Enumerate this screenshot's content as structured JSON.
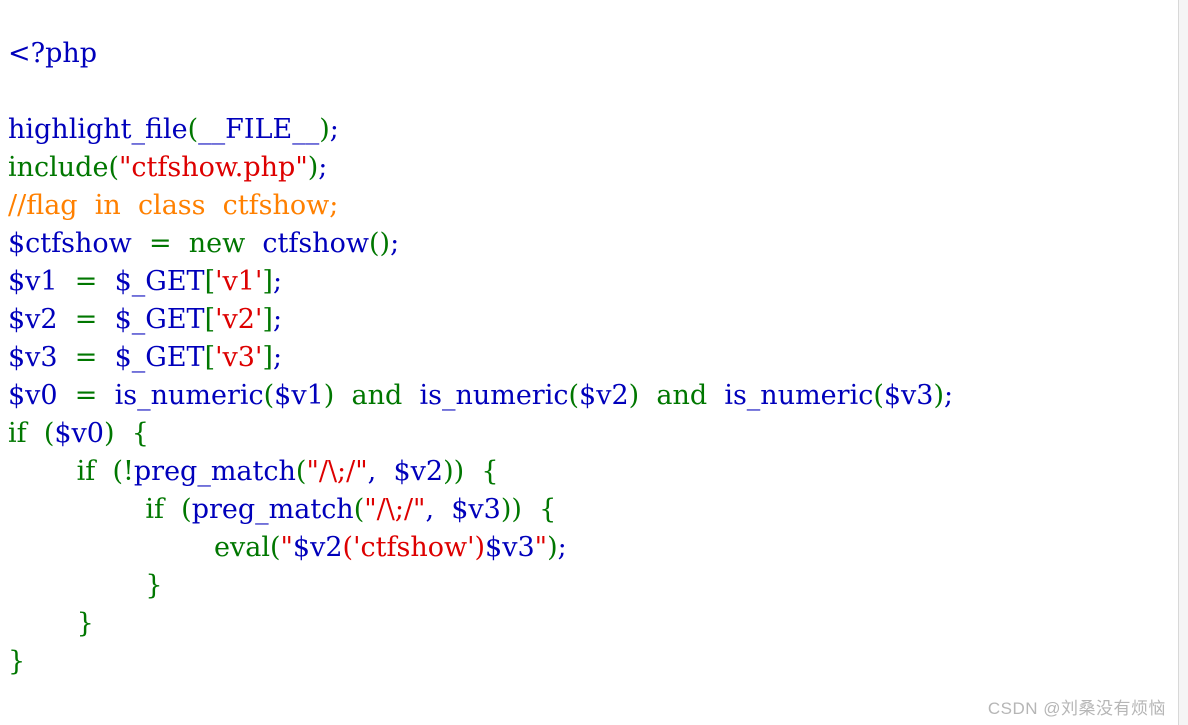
{
  "editor": {
    "language": "php",
    "background": "#ffffff",
    "palette": {
      "default": "#0000BB",
      "keyword": "#007700",
      "string": "#DD0000",
      "comment": "#FF8000"
    },
    "lines": [
      {
        "index": 1,
        "text": "<?php"
      },
      {
        "index": 2,
        "text": ""
      },
      {
        "index": 3,
        "text": "highlight_file(__FILE__);"
      },
      {
        "index": 4,
        "text": "include(\"ctfshow.php\");"
      },
      {
        "index": 5,
        "text": "//flag  in  class  ctfshow;"
      },
      {
        "index": 6,
        "text": "$ctfshow  =  new  ctfshow();"
      },
      {
        "index": 7,
        "text": "$v1  =  $_GET['v1'];"
      },
      {
        "index": 8,
        "text": "$v2  =  $_GET['v2'];"
      },
      {
        "index": 9,
        "text": "$v3  =  $_GET['v3'];"
      },
      {
        "index": 10,
        "text": "$v0  =  is_numeric($v1)  and  is_numeric($v2)  and  is_numeric($v3);"
      },
      {
        "index": 11,
        "text": "if  ($v0)  {"
      },
      {
        "index": 12,
        "text": "        if  (!preg_match(\"/\\;/\",  $v2))  {"
      },
      {
        "index": 13,
        "text": "                if  (preg_match(\"/\\;/\",  $v3))  {"
      },
      {
        "index": 14,
        "text": "                        eval(\"$v2('ctfshow')$v3\");"
      },
      {
        "index": 15,
        "text": "                }"
      },
      {
        "index": 16,
        "text": "        }"
      },
      {
        "index": 17,
        "text": "}"
      }
    ],
    "tokens": [
      [
        {
          "t": "<?php",
          "c": "default"
        }
      ],
      [
        {
          "t": "",
          "c": "default"
        }
      ],
      [
        {
          "t": "highlight_file",
          "c": "default"
        },
        {
          "t": "(",
          "c": "keyword"
        },
        {
          "t": "__FILE__",
          "c": "default"
        },
        {
          "t": ")",
          "c": "keyword"
        },
        {
          "t": ";",
          "c": "default"
        }
      ],
      [
        {
          "t": "include",
          "c": "keyword"
        },
        {
          "t": "(",
          "c": "keyword"
        },
        {
          "t": "\"ctfshow.php\"",
          "c": "string"
        },
        {
          "t": ")",
          "c": "keyword"
        },
        {
          "t": ";",
          "c": "default"
        }
      ],
      [
        {
          "t": "//flag  in  class  ctfshow;",
          "c": "comment"
        }
      ],
      [
        {
          "t": "$ctfshow",
          "c": "default"
        },
        {
          "t": "  ",
          "c": "default"
        },
        {
          "t": "=",
          "c": "keyword"
        },
        {
          "t": "  ",
          "c": "default"
        },
        {
          "t": "new",
          "c": "keyword"
        },
        {
          "t": "  ",
          "c": "default"
        },
        {
          "t": "ctfshow",
          "c": "default"
        },
        {
          "t": "(",
          "c": "keyword"
        },
        {
          "t": ")",
          "c": "keyword"
        },
        {
          "t": ";",
          "c": "default"
        }
      ],
      [
        {
          "t": "$v1",
          "c": "default"
        },
        {
          "t": "  ",
          "c": "default"
        },
        {
          "t": "=",
          "c": "keyword"
        },
        {
          "t": "  ",
          "c": "default"
        },
        {
          "t": "$_GET",
          "c": "default"
        },
        {
          "t": "[",
          "c": "keyword"
        },
        {
          "t": "'v1'",
          "c": "string"
        },
        {
          "t": "]",
          "c": "keyword"
        },
        {
          "t": ";",
          "c": "default"
        }
      ],
      [
        {
          "t": "$v2",
          "c": "default"
        },
        {
          "t": "  ",
          "c": "default"
        },
        {
          "t": "=",
          "c": "keyword"
        },
        {
          "t": "  ",
          "c": "default"
        },
        {
          "t": "$_GET",
          "c": "default"
        },
        {
          "t": "[",
          "c": "keyword"
        },
        {
          "t": "'v2'",
          "c": "string"
        },
        {
          "t": "]",
          "c": "keyword"
        },
        {
          "t": ";",
          "c": "default"
        }
      ],
      [
        {
          "t": "$v3",
          "c": "default"
        },
        {
          "t": "  ",
          "c": "default"
        },
        {
          "t": "=",
          "c": "keyword"
        },
        {
          "t": "  ",
          "c": "default"
        },
        {
          "t": "$_GET",
          "c": "default"
        },
        {
          "t": "[",
          "c": "keyword"
        },
        {
          "t": "'v3'",
          "c": "string"
        },
        {
          "t": "]",
          "c": "keyword"
        },
        {
          "t": ";",
          "c": "default"
        }
      ],
      [
        {
          "t": "$v0",
          "c": "default"
        },
        {
          "t": "  ",
          "c": "default"
        },
        {
          "t": "=",
          "c": "keyword"
        },
        {
          "t": "  ",
          "c": "default"
        },
        {
          "t": "is_numeric",
          "c": "default"
        },
        {
          "t": "(",
          "c": "keyword"
        },
        {
          "t": "$v1",
          "c": "default"
        },
        {
          "t": ")",
          "c": "keyword"
        },
        {
          "t": "  ",
          "c": "default"
        },
        {
          "t": "and",
          "c": "keyword"
        },
        {
          "t": "  ",
          "c": "default"
        },
        {
          "t": "is_numeric",
          "c": "default"
        },
        {
          "t": "(",
          "c": "keyword"
        },
        {
          "t": "$v2",
          "c": "default"
        },
        {
          "t": ")",
          "c": "keyword"
        },
        {
          "t": "  ",
          "c": "default"
        },
        {
          "t": "and",
          "c": "keyword"
        },
        {
          "t": "  ",
          "c": "default"
        },
        {
          "t": "is_numeric",
          "c": "default"
        },
        {
          "t": "(",
          "c": "keyword"
        },
        {
          "t": "$v3",
          "c": "default"
        },
        {
          "t": ")",
          "c": "keyword"
        },
        {
          "t": ";",
          "c": "default"
        }
      ],
      [
        {
          "t": "if",
          "c": "keyword"
        },
        {
          "t": "  ",
          "c": "default"
        },
        {
          "t": "(",
          "c": "keyword"
        },
        {
          "t": "$v0",
          "c": "default"
        },
        {
          "t": ")",
          "c": "keyword"
        },
        {
          "t": "  ",
          "c": "default"
        },
        {
          "t": "{",
          "c": "keyword"
        }
      ],
      [
        {
          "t": "        ",
          "c": "default"
        },
        {
          "t": "if",
          "c": "keyword"
        },
        {
          "t": "  ",
          "c": "default"
        },
        {
          "t": "(!",
          "c": "keyword"
        },
        {
          "t": "preg_match",
          "c": "default"
        },
        {
          "t": "(",
          "c": "keyword"
        },
        {
          "t": "\"/\\;/\"",
          "c": "string"
        },
        {
          "t": ",",
          "c": "default"
        },
        {
          "t": "  ",
          "c": "default"
        },
        {
          "t": "$v2",
          "c": "default"
        },
        {
          "t": "))",
          "c": "keyword"
        },
        {
          "t": "  ",
          "c": "default"
        },
        {
          "t": "{",
          "c": "keyword"
        }
      ],
      [
        {
          "t": "                ",
          "c": "default"
        },
        {
          "t": "if",
          "c": "keyword"
        },
        {
          "t": "  ",
          "c": "default"
        },
        {
          "t": "(",
          "c": "keyword"
        },
        {
          "t": "preg_match",
          "c": "default"
        },
        {
          "t": "(",
          "c": "keyword"
        },
        {
          "t": "\"/\\;/\"",
          "c": "string"
        },
        {
          "t": ",",
          "c": "default"
        },
        {
          "t": "  ",
          "c": "default"
        },
        {
          "t": "$v3",
          "c": "default"
        },
        {
          "t": "))",
          "c": "keyword"
        },
        {
          "t": "  ",
          "c": "default"
        },
        {
          "t": "{",
          "c": "keyword"
        }
      ],
      [
        {
          "t": "                        ",
          "c": "default"
        },
        {
          "t": "eval",
          "c": "keyword"
        },
        {
          "t": "(",
          "c": "keyword"
        },
        {
          "t": "\"",
          "c": "string"
        },
        {
          "t": "$v2",
          "c": "default"
        },
        {
          "t": "('ctfshow')",
          "c": "string"
        },
        {
          "t": "$v3",
          "c": "default"
        },
        {
          "t": "\"",
          "c": "string"
        },
        {
          "t": ")",
          "c": "keyword"
        },
        {
          "t": ";",
          "c": "default"
        }
      ],
      [
        {
          "t": "                ",
          "c": "default"
        },
        {
          "t": "}",
          "c": "keyword"
        }
      ],
      [
        {
          "t": "        ",
          "c": "default"
        },
        {
          "t": "}",
          "c": "keyword"
        }
      ],
      [
        {
          "t": "}",
          "c": "keyword"
        }
      ]
    ]
  },
  "watermark": {
    "text": "CSDN @刘桑没有烦恼"
  }
}
